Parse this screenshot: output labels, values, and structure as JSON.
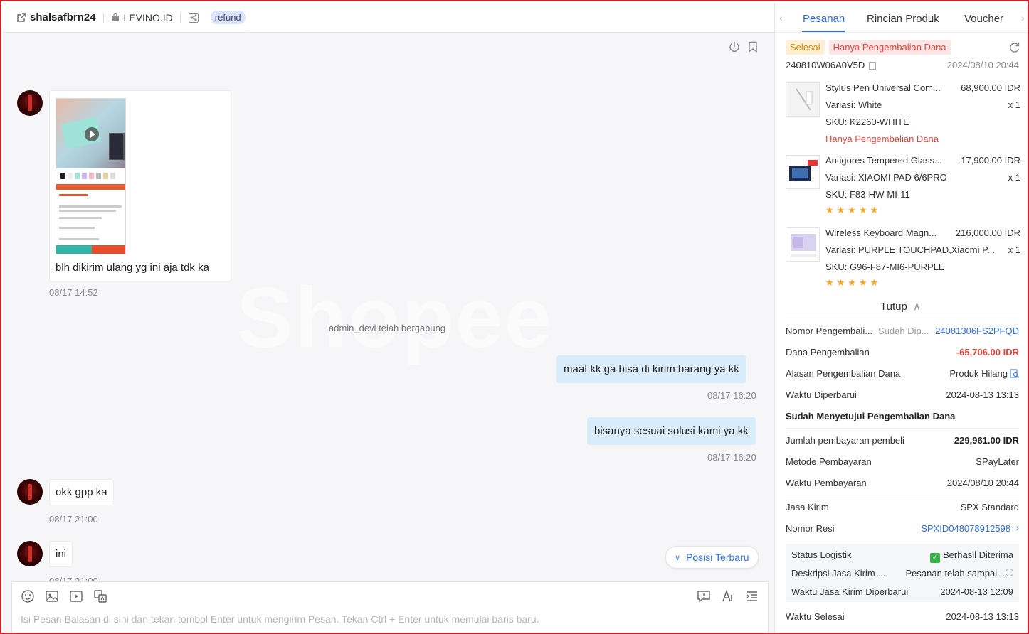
{
  "header": {
    "username": "shalsafbrn24",
    "shop": "LEVINO.ID",
    "tag": "refund"
  },
  "chat": {
    "watermark": "Shopee",
    "messages": [
      {
        "text": "blh dikirim ulang yg ini aja tdk ka",
        "time": "08/17 14:52"
      },
      {
        "system": "admin_devi telah bergabung"
      },
      {
        "text": "maaf kk ga bisa di kirim barang ya kk",
        "time": "08/17 16:20"
      },
      {
        "text": "bisanya sesuai solusi kami ya kk",
        "time": "08/17 16:20"
      },
      {
        "text": "okk gpp ka",
        "time": "08/17 21:00"
      },
      {
        "text": "ini",
        "time": "08/17 21:00"
      }
    ],
    "jump_button": "Posisi Terbaru",
    "composer_placeholder": "Isi Pesan Balasan di sini dan tekan tombol Enter untuk mengirim Pesan. Tekan Ctrl + Enter untuk memulai baris baru."
  },
  "side": {
    "tabs": [
      "Pesanan",
      "Rincian Produk",
      "Voucher"
    ],
    "status_badges": [
      "Selesai",
      "Hanya Pengembalian Dana"
    ],
    "order_id": "240810W06A0V5D",
    "order_date": "2024/08/10 20:44",
    "products": [
      {
        "name": "Stylus Pen Universal Com...",
        "price": "68,900.00 IDR",
        "variation": "Variasi:  White",
        "qty": "x 1",
        "sku": "SKU:  K2260-WHITE",
        "note": "Hanya Pengembalian Dana"
      },
      {
        "name": "Antigores Tempered Glass...",
        "price": "17,900.00 IDR",
        "variation": "Variasi:  XIAOMI PAD 6/6PRO",
        "qty": "x 1",
        "sku": "SKU:  F83-HW-MI-11",
        "stars": "★★★★★"
      },
      {
        "name": "Wireless Keyboard Magn...",
        "price": "216,000.00 IDR",
        "variation": "Variasi:  PURPLE TOUCHPAD,Xiaomi P...",
        "qty": "x 1",
        "sku": "SKU:  G96-F87-MI6-PURPLE",
        "stars": "★★★★★"
      }
    ],
    "collapse_label": "Tutup",
    "refund": {
      "number_label": "Nomor Pengembali...",
      "number_status": "Sudah Dip...",
      "number_value": "24081306FS2PFQD",
      "amount_label": "Dana Pengembalian",
      "amount_value": "-65,706.00 IDR",
      "reason_label": "Alasan Pengembalian Dana",
      "reason_value": "Produk Hilang",
      "updated_label": "Waktu Diperbarui",
      "updated_value": "2024-08-13 13:13",
      "approved_title": "Sudah Menyetujui Pengembalian Dana"
    },
    "payment": {
      "amount_label": "Jumlah pembayaran pembeli",
      "amount_value": "229,961.00 IDR",
      "method_label": "Metode Pembayaran",
      "method_value": "SPayLater",
      "time_label": "Waktu Pembayaran",
      "time_value": "2024/08/10 20:44"
    },
    "shipping": {
      "courier_label": "Jasa Kirim",
      "courier_value": "SPX Standard",
      "tracking_label": "Nomor Resi",
      "tracking_value": "SPXID048078912598"
    },
    "logistics": {
      "status_label": "Status Logistik",
      "status_value": "Berhasil Diterima",
      "desc_label": "Deskripsi Jasa Kirim ...",
      "desc_value": "Pesanan telah sampai...",
      "time_label": "Waktu Jasa Kirim Diperbarui",
      "time_value": "2024-08-13 12:09"
    },
    "completed_label": "Waktu Selesai",
    "completed_value": "2024-08-13 13:13"
  },
  "colors": {
    "accent": "#2f6de1",
    "outgoing_bubble": "#d9ecfb",
    "danger": "#e0453d",
    "window_border": "#c4262e"
  }
}
